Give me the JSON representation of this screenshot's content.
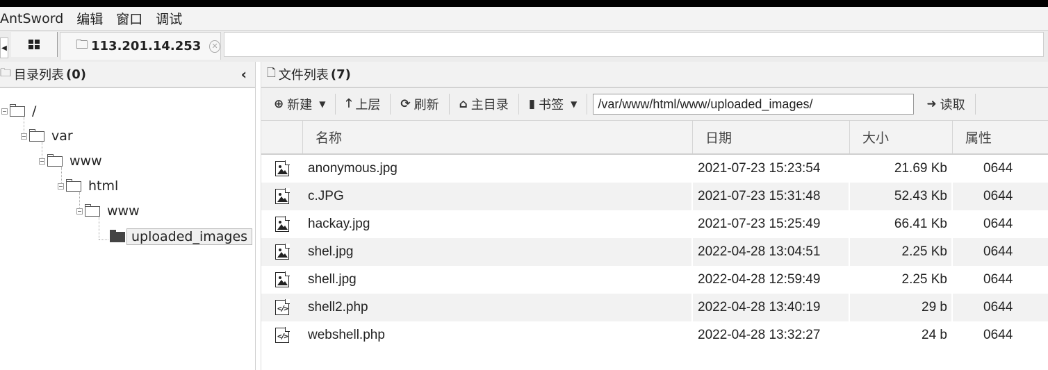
{
  "menubar": {
    "items": [
      "AntSword",
      "编辑",
      "窗口",
      "调试"
    ]
  },
  "tabs": {
    "active_label": "113.201.14.253"
  },
  "dir_panel": {
    "title": "目录列表",
    "count": "(0)",
    "tree": [
      {
        "label": "/"
      },
      {
        "label": "var"
      },
      {
        "label": "www"
      },
      {
        "label": "html"
      },
      {
        "label": "www"
      },
      {
        "label": "uploaded_images"
      }
    ]
  },
  "file_panel": {
    "title": "文件列表",
    "count": "(7)",
    "toolbar": {
      "new_label": "新建",
      "up_label": "上层",
      "refresh_label": "刷新",
      "home_label": "主目录",
      "bookmark_label": "书签",
      "path_value": "/var/www/html/www/uploaded_images/",
      "read_label": "读取"
    },
    "columns": [
      "名称",
      "日期",
      "大小",
      "属性"
    ],
    "rows": [
      {
        "icon": "image-file-icon",
        "name": "anonymous.jpg",
        "date": "2021-07-23 15:23:54",
        "size": "21.69 Kb",
        "attr": "0644"
      },
      {
        "icon": "image-file-icon",
        "name": "c.JPG",
        "date": "2021-07-23 15:31:48",
        "size": "52.43 Kb",
        "attr": "0644"
      },
      {
        "icon": "image-file-icon",
        "name": "hackay.jpg",
        "date": "2021-07-23 15:25:49",
        "size": "66.41 Kb",
        "attr": "0644"
      },
      {
        "icon": "image-file-icon",
        "name": "shel.jpg",
        "date": "2022-04-28 13:04:51",
        "size": "2.25 Kb",
        "attr": "0644"
      },
      {
        "icon": "image-file-icon",
        "name": "shell.jpg",
        "date": "2022-04-28 12:59:49",
        "size": "2.25 Kb",
        "attr": "0644"
      },
      {
        "icon": "code-file-icon",
        "name": "shell2.php",
        "date": "2022-04-28 13:40:19",
        "size": "29 b",
        "attr": "0644"
      },
      {
        "icon": "code-file-icon",
        "name": "webshell.php",
        "date": "2022-04-28 13:32:27",
        "size": "24 b",
        "attr": "0644"
      }
    ]
  }
}
